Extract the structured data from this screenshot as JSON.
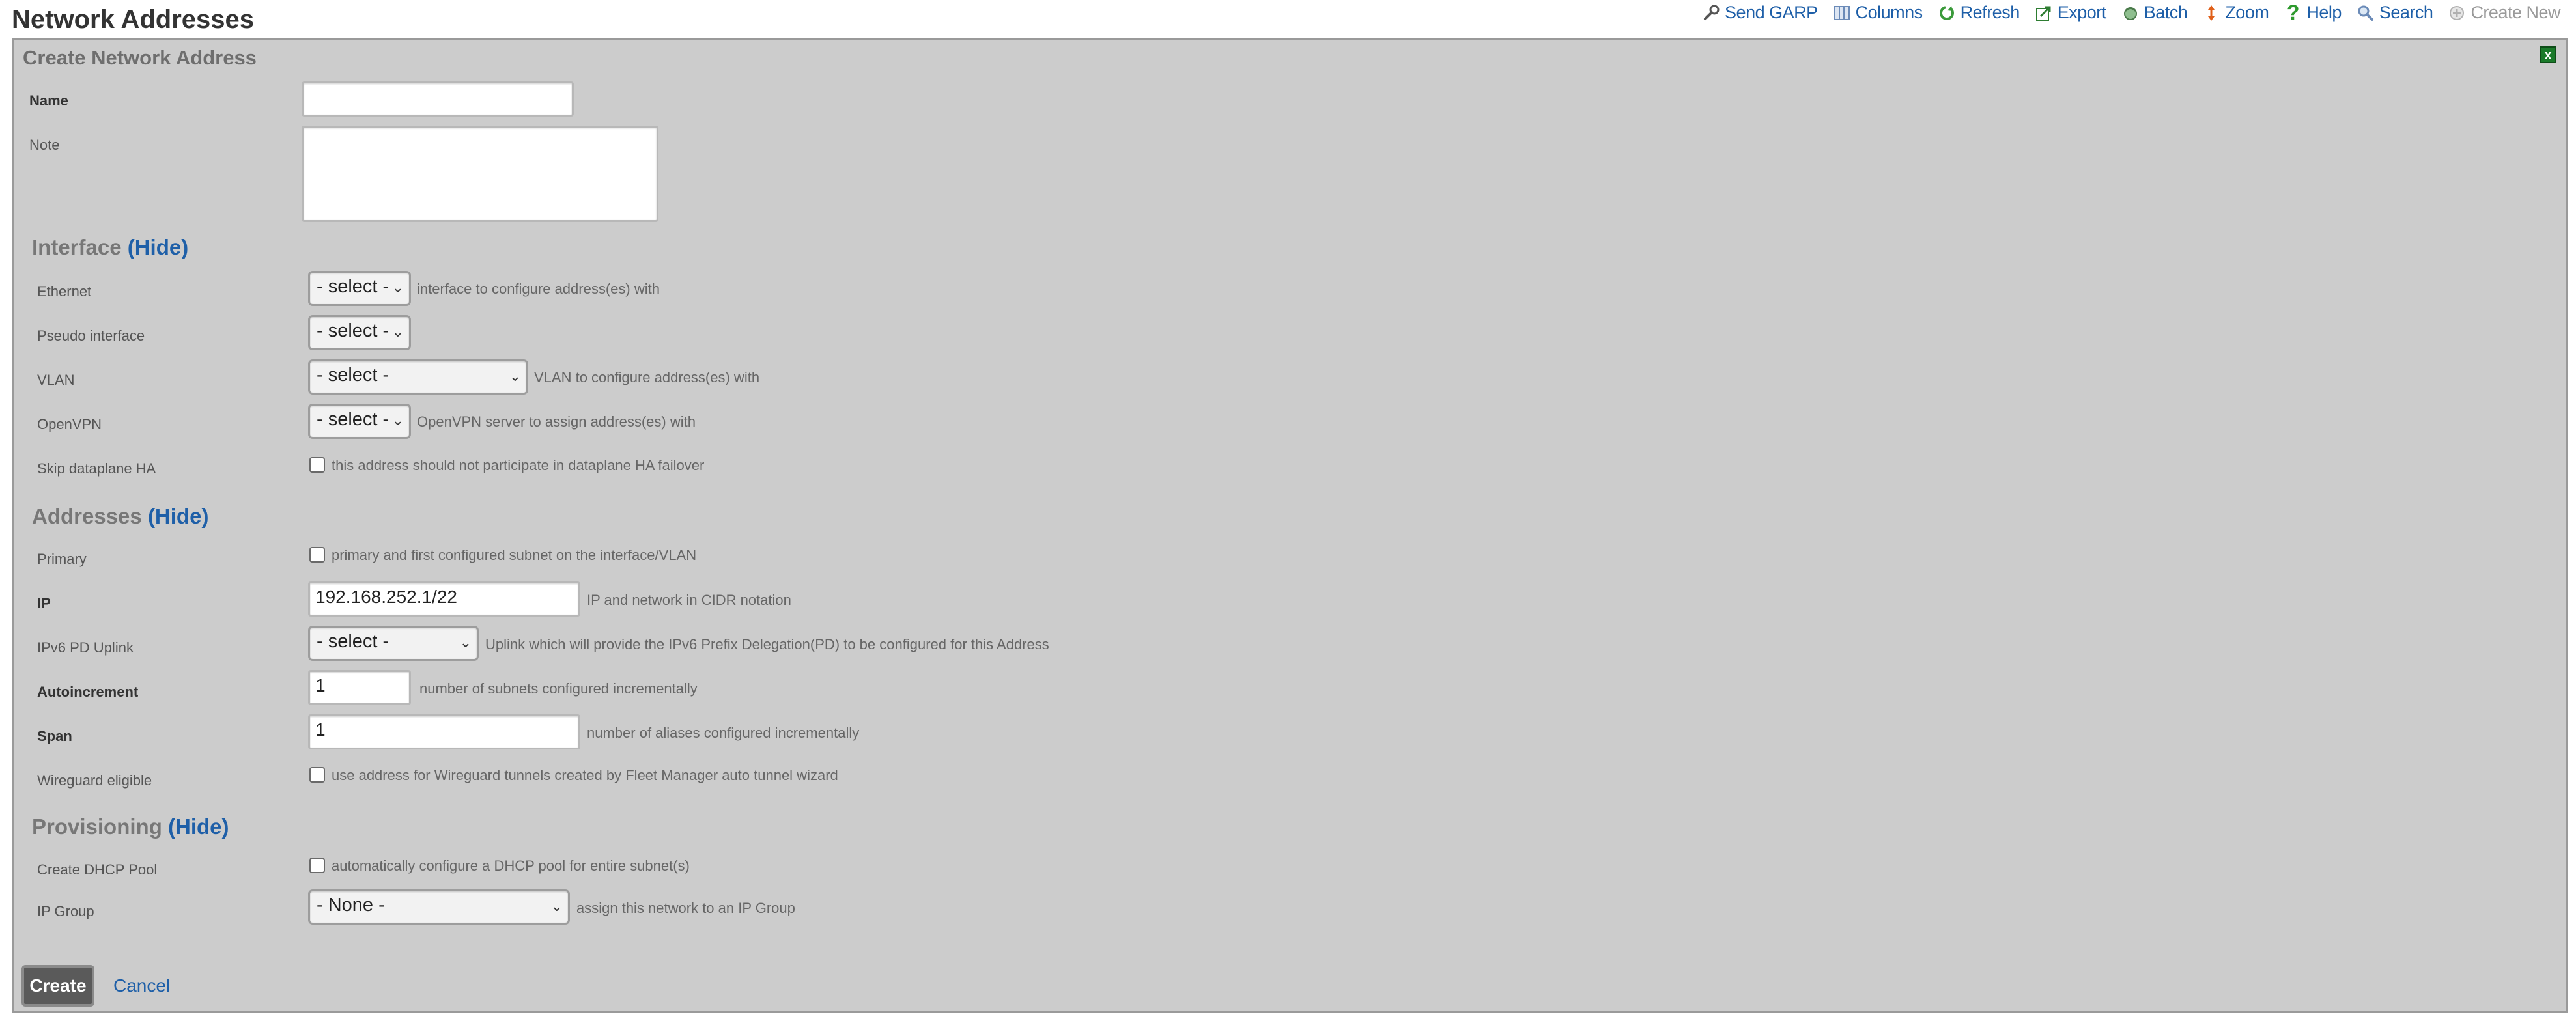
{
  "page": {
    "title": "Network Addresses"
  },
  "toolbar": [
    {
      "label": "Send GARP",
      "icon": "wrench-icon",
      "enabled": true
    },
    {
      "label": "Columns",
      "icon": "columns-icon",
      "enabled": true
    },
    {
      "label": "Refresh",
      "icon": "refresh-icon",
      "enabled": true
    },
    {
      "label": "Export",
      "icon": "export-icon",
      "enabled": true
    },
    {
      "label": "Batch",
      "icon": "batch-icon",
      "enabled": true
    },
    {
      "label": "Zoom",
      "icon": "zoom-icon",
      "enabled": true
    },
    {
      "label": "Help",
      "icon": "help-icon",
      "enabled": true
    },
    {
      "label": "Search",
      "icon": "search-icon",
      "enabled": true
    },
    {
      "label": "Create New",
      "icon": "add-icon",
      "enabled": false
    }
  ],
  "panel": {
    "title": "Create Network Address",
    "close": "x"
  },
  "fields": {
    "name": {
      "label": "Name",
      "value": ""
    },
    "note": {
      "label": "Note",
      "value": ""
    }
  },
  "sections": {
    "interface": {
      "title": "Interface",
      "toggle": "(Hide)"
    },
    "addresses": {
      "title": "Addresses",
      "toggle": "(Hide)"
    },
    "provisioning": {
      "title": "Provisioning",
      "toggle": "(Hide)"
    }
  },
  "interface": {
    "ethernet": {
      "label": "Ethernet",
      "value": "- select -",
      "help": "interface to configure address(es) with"
    },
    "pseudo": {
      "label": "Pseudo interface",
      "value": "- select -"
    },
    "vlan": {
      "label": "VLAN",
      "value": "- select -",
      "help": "VLAN to configure address(es) with"
    },
    "openvpn": {
      "label": "OpenVPN",
      "value": "- select -",
      "help": "OpenVPN server to assign address(es) with"
    },
    "skip_ha": {
      "label": "Skip dataplane HA",
      "help": "this address should not participate in dataplane HA failover",
      "checked": false
    }
  },
  "addresses": {
    "primary": {
      "label": "Primary",
      "help": "primary and first configured subnet on the interface/VLAN",
      "checked": false
    },
    "ip": {
      "label": "IP",
      "value": "192.168.252.1/22",
      "help": "IP and network in CIDR notation"
    },
    "ipv6pd": {
      "label": "IPv6 PD Uplink",
      "value": "- select -",
      "help": "Uplink which will provide the IPv6 Prefix Delegation(PD) to be configured for this Address"
    },
    "autoincrement": {
      "label": "Autoincrement",
      "value": "1",
      "help": "number of subnets configured incrementally"
    },
    "span": {
      "label": "Span",
      "value": "1",
      "help": "number of aliases configured incrementally"
    },
    "wireguard": {
      "label": "Wireguard eligible",
      "help": "use address for Wireguard tunnels created by Fleet Manager auto tunnel wizard",
      "checked": false
    }
  },
  "provisioning": {
    "dhcp": {
      "label": "Create DHCP Pool",
      "help": "automatically configure a DHCP pool for entire subnet(s)",
      "checked": false
    },
    "ipgroup": {
      "label": "IP Group",
      "value": "- None -",
      "help": "assign this network to an IP Group"
    }
  },
  "actions": {
    "create": "Create",
    "cancel": "Cancel"
  }
}
